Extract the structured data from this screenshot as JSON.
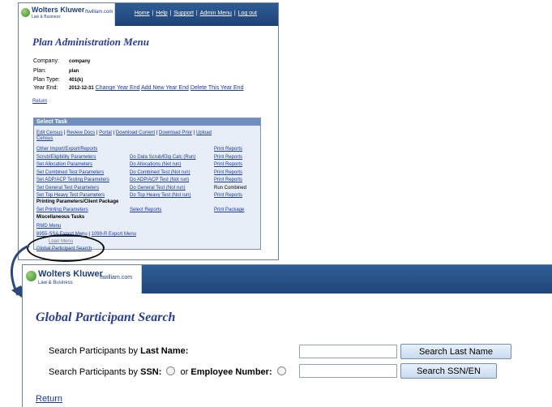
{
  "branding": {
    "company": "Wolters Kluwer",
    "division": "Law & Business",
    "product": "ftwilliam.com"
  },
  "top_window": {
    "nav": [
      "Home",
      "Help",
      "Support",
      "Admin Menu",
      "Log out"
    ],
    "title": "Plan Administration Menu",
    "info": {
      "company_label": "Company:",
      "company_value": "company",
      "plan_label": "Plan:",
      "plan_value": "plan",
      "plan_type_label": "Plan Type:",
      "plan_type_value": "401(k)",
      "year_end_label": "Year End:",
      "year_end_value": "2012-12-31",
      "change_year_end": "Change Year End",
      "add_year_end": "Add New Year End",
      "delete_year_end": "Delete This Year End"
    },
    "return_label": "Return",
    "select_task": {
      "header": "Select Task",
      "top_links": [
        "Edit Census",
        "Review Docs",
        "Portal",
        "Download Current",
        "Download Prior",
        "Upload"
      ],
      "census_wrap": "Census",
      "other_import": "Other Import/Export/Reports",
      "print_reports": "Print Reports",
      "rows": [
        {
          "left": "Scrub/Eligibility Parameters",
          "mid": "Do Data Scrub/Elig Calc (Run)",
          "right": "Print Reports"
        },
        {
          "left": "Set Allocation Parameters",
          "mid": "Do Allocations (Not run)",
          "right": "Print Reports"
        },
        {
          "left": "Set Combined Test Parameters",
          "mid": "Do Combined Test (Not run)",
          "right": "Print Reports"
        },
        {
          "left": "Set ADP/ACP Testing Parameters",
          "mid": "Do ADP/ACP Test (Not run)",
          "right": "Print Reports"
        },
        {
          "left": "Set General Test Parameters",
          "mid": "Do General Test (Not run)",
          "right": "Run Combined"
        },
        {
          "left": "Set Top Heavy Test Parameters",
          "mid": "Do Top Heavy Test (Not run)",
          "right": "Print Reports"
        }
      ],
      "printing_heading": "Printing Parameters/Client Package",
      "set_printing": "Set Printing Parameters",
      "select_reports": "Select Reports",
      "print_package": "Print Package",
      "misc_heading": "Miscellaneous Tasks",
      "rmd_menu": "RMD Menu",
      "ssa_export": "8955-SSA Export Menu",
      "r1099_export": "1099-R Export Menu",
      "loan_menu": "Loan Menu",
      "global_search": "Global Participant Search"
    }
  },
  "bottom_window": {
    "title": "Global Participant Search",
    "lastname_prefix": "Search Participants by ",
    "lastname_bold": "Last Name:",
    "ssn_prefix": "Search Participants by ",
    "ssn_bold": "SSN:",
    "or_text": "or",
    "empno_bold": "Employee Number:",
    "btn_last_name": "Search Last Name",
    "btn_ssn_en": "Search SSN/EN",
    "return_label": "Return",
    "lastname_value": "",
    "ssn_value": ""
  },
  "colors": {
    "header_blue": "#1f4479",
    "title_blue": "#2a3d8f",
    "link_blue": "#1a3a9c"
  }
}
